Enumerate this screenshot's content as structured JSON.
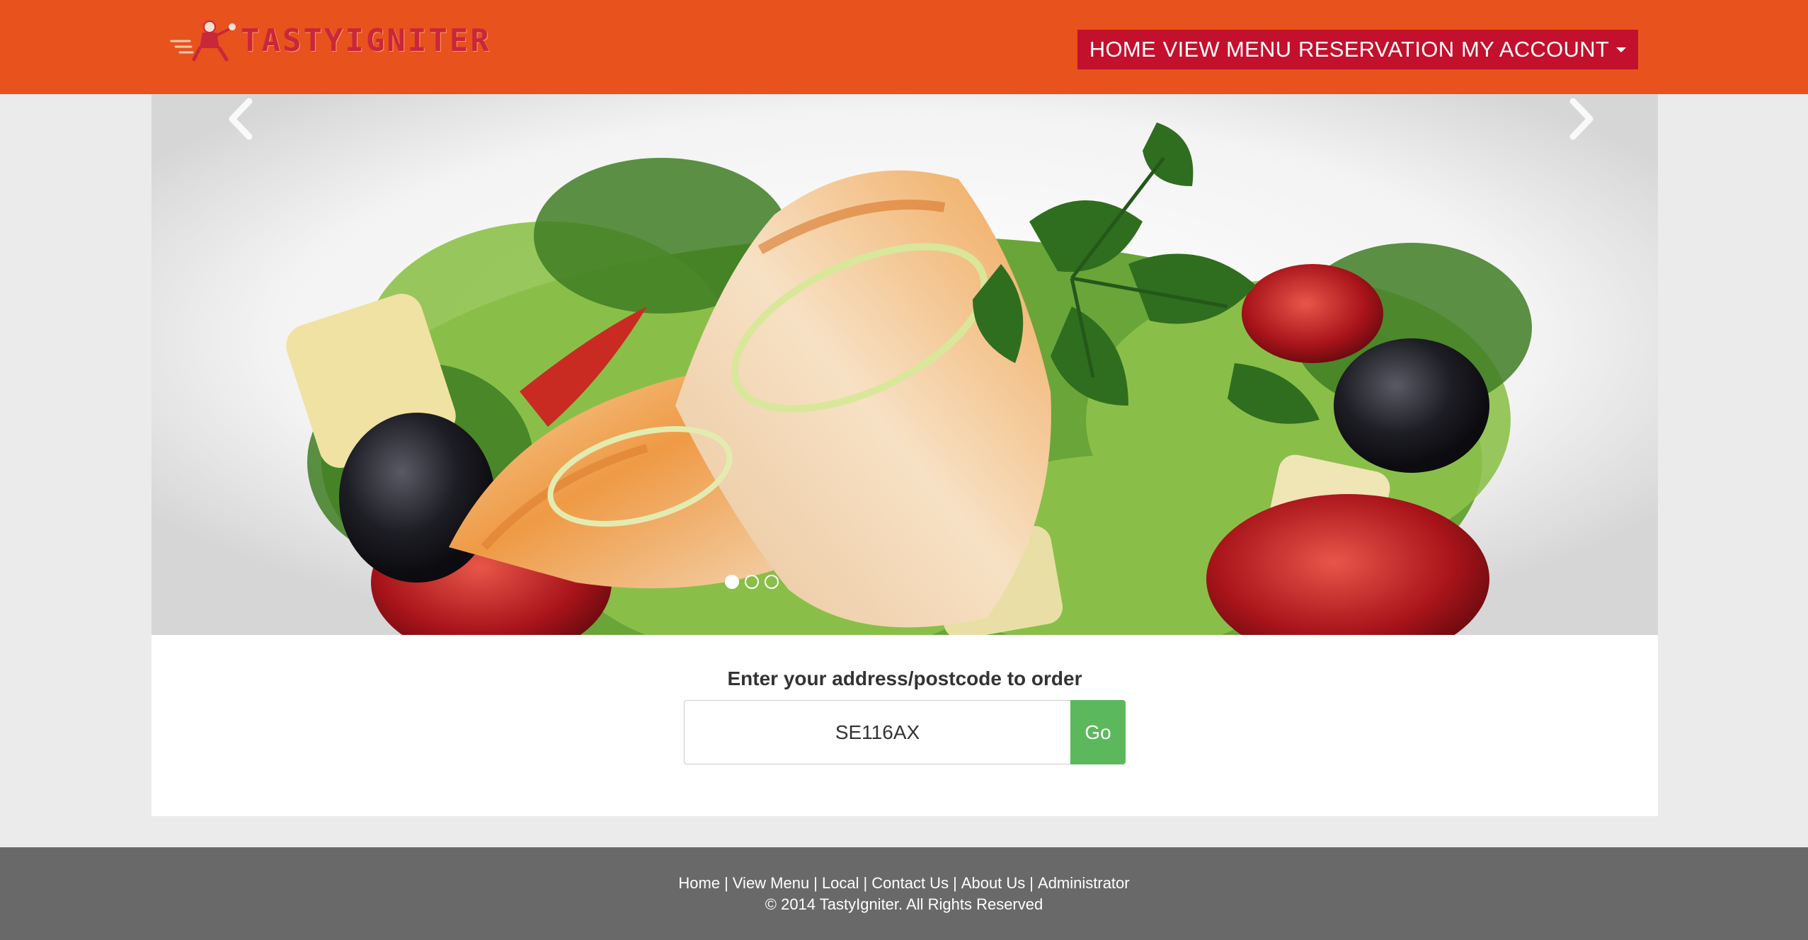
{
  "header": {
    "logo_text": "TASTYIGNITER",
    "nav": [
      {
        "label": "HOME"
      },
      {
        "label": "VIEW MENU"
      },
      {
        "label": "RESERVATION"
      },
      {
        "label": "MY ACCOUNT"
      }
    ]
  },
  "hero": {
    "slide_count": 3,
    "active_slide": 1
  },
  "search": {
    "label": "Enter your address/postcode to order",
    "value": "SE116AX",
    "button": "Go"
  },
  "footer": {
    "links": [
      {
        "label": "Home"
      },
      {
        "label": "View Menu"
      },
      {
        "label": "Local"
      },
      {
        "label": "Contact Us"
      },
      {
        "label": "About Us"
      },
      {
        "label": "Administrator"
      }
    ],
    "separator": "|",
    "copyright": "© 2014 TastyIgniter. All Rights Reserved"
  },
  "colors": {
    "header_bg": "#e8521d",
    "nav_bg": "#c3102c",
    "go_button": "#5cb85c",
    "footer_bg": "#696969",
    "page_bg": "#ebebeb"
  }
}
